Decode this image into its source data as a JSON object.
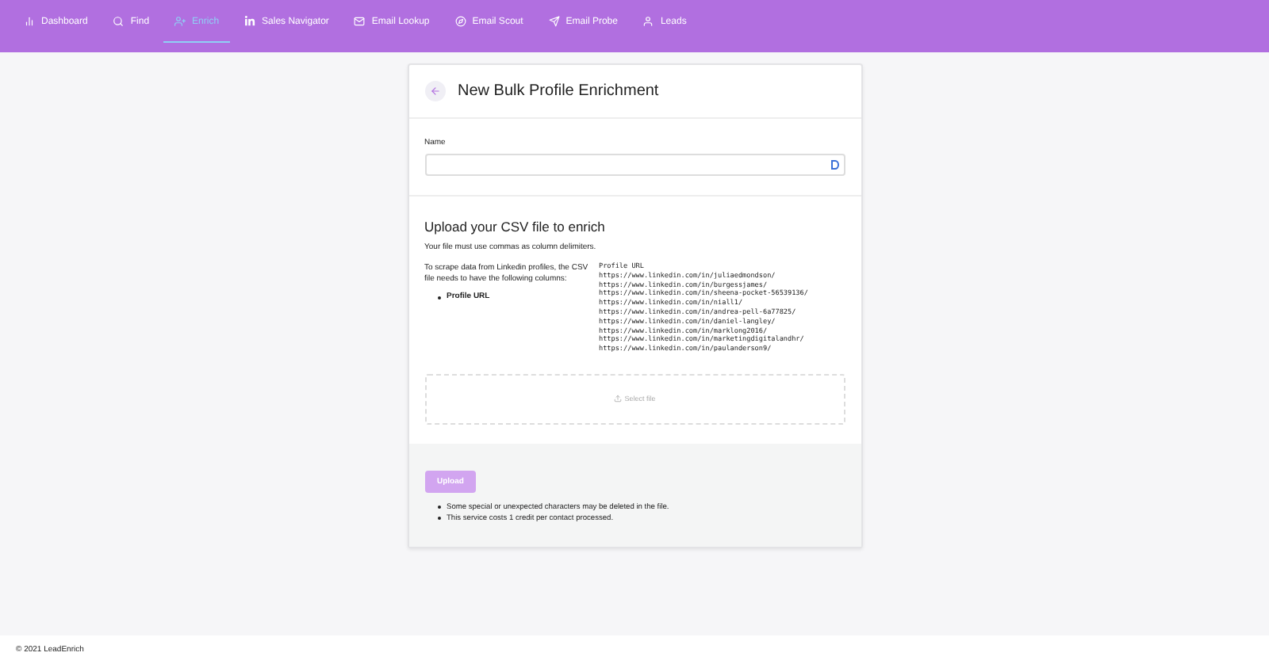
{
  "nav": {
    "items": [
      {
        "label": "Dashboard",
        "selected": false
      },
      {
        "label": "Find",
        "selected": false
      },
      {
        "label": "Enrich",
        "selected": true
      },
      {
        "label": "Sales Navigator",
        "selected": false
      },
      {
        "label": "Email Lookup",
        "selected": false
      },
      {
        "label": "Email Scout",
        "selected": false
      },
      {
        "label": "Email Probe",
        "selected": false
      },
      {
        "label": "Leads",
        "selected": false
      }
    ]
  },
  "card": {
    "title": "New Bulk Profile Enrichment",
    "name_field": {
      "label": "Name"
    },
    "upload": {
      "heading": "Upload your CSV file to enrich",
      "note": "Your file must use commas as column delimiters.",
      "intro": "To scrape data from Linkedin profiles, the CSV file needs to have the following columns:",
      "columns": [
        "Profile URL"
      ],
      "sample": [
        "Profile URL",
        "https://www.linkedin.com/in/juliaedmondson/",
        "https://www.linkedin.com/in/burgessjames/",
        "https://www.linkedin.com/in/sheena-pocket-56539136/",
        "https://www.linkedin.com/in/niall1/",
        "https://www.linkedin.com/in/andrea-pell-6a77825/",
        "https://www.linkedin.com/in/daniel-langley/",
        "https://www.linkedin.com/in/marklong2016/",
        "https://www.linkedin.com/in/marketingdigitalandhr/",
        "https://www.linkedin.com/in/paulanderson9/"
      ],
      "dropzone": "Select file"
    },
    "button": {
      "label": "Upload",
      "disabled": true
    },
    "notes": [
      "Some special or unexpected characters may be deleted in the file.",
      "This service costs 1 credit per contact processed."
    ]
  },
  "footer": "© 2021 LeadEnrich"
}
